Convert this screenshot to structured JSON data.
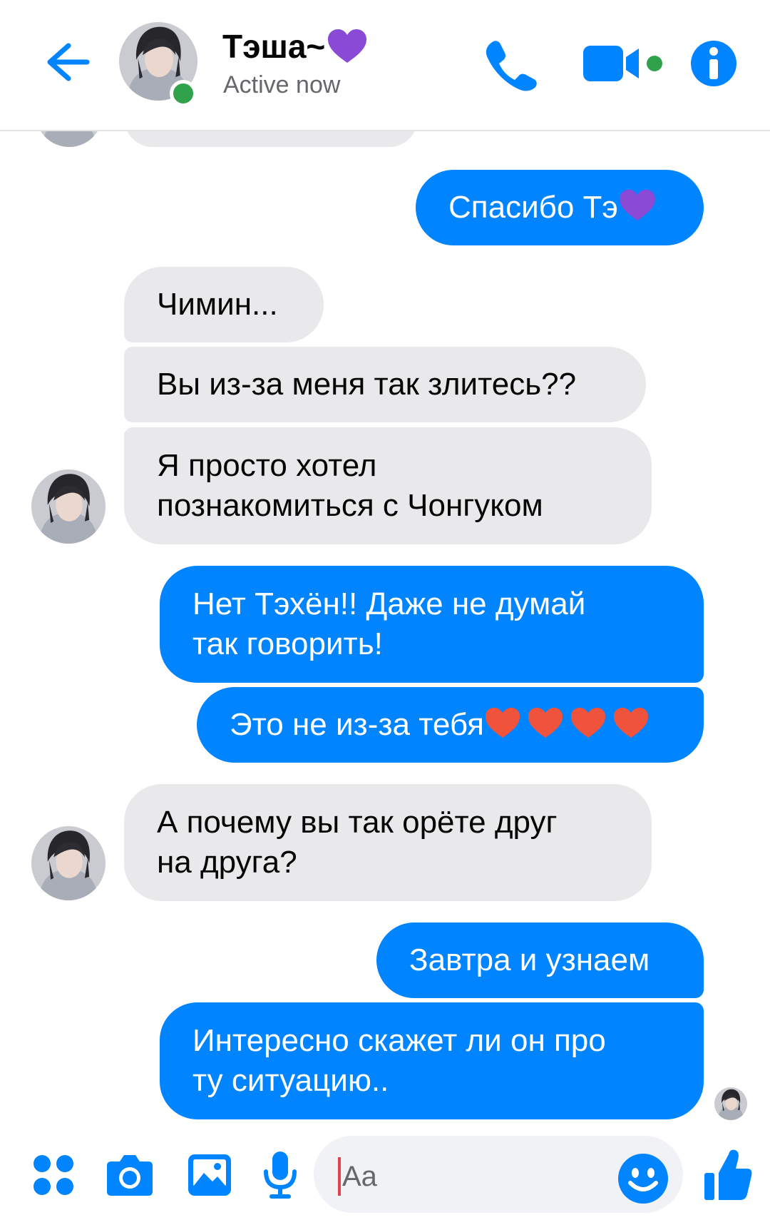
{
  "header": {
    "title": "Тэша~",
    "status": "Active now"
  },
  "messages": [
    {
      "side": "in",
      "text": "Чимин..."
    },
    {
      "side": "in",
      "text": "Вы из-за меня так злитесь??"
    },
    {
      "side": "in",
      "text": "Я просто хотел\nпознакомиться с Чонгуком"
    },
    {
      "side": "out",
      "text": "Спасибо Тэ"
    },
    {
      "side": "out",
      "text": "Нет Тэхён!! Даже не думай\nтак говорить!"
    },
    {
      "side": "out",
      "text": "Это не из-за тебя"
    },
    {
      "side": "in",
      "text": "А почему вы так орёте друг\nна друга?"
    },
    {
      "side": "out",
      "text": "Завтра и узнаем"
    },
    {
      "side": "out",
      "text": "Интересно скажет ли он про\nту ситуацию.."
    }
  ],
  "composer": {
    "placeholder": "Aa"
  },
  "icons": {
    "back": "arrow-left-icon",
    "call": "phone-icon",
    "video": "video-camera-icon",
    "info": "info-icon",
    "apps": "apps-grid-icon",
    "camera": "camera-icon",
    "gallery": "image-icon",
    "voice": "microphone-icon",
    "emoji": "smiley-icon",
    "like": "thumbs-up-icon"
  },
  "colors": {
    "accent": "#0084ff",
    "incoming_bubble": "#e9e9eb",
    "online": "#31a24c",
    "purple_heart": "#8a4ad6",
    "red_heart": "#f0533c"
  }
}
